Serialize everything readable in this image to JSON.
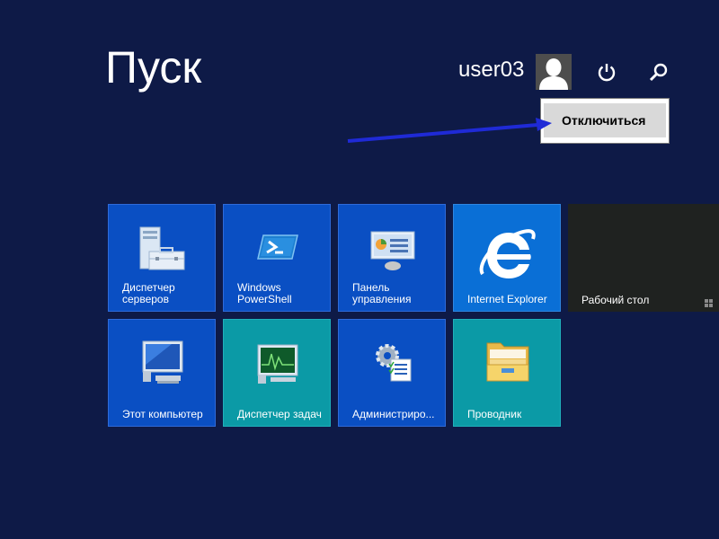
{
  "start": {
    "title": "Пуск"
  },
  "user": {
    "name": "user03"
  },
  "power_menu": {
    "items": [
      {
        "label": "Отключиться"
      }
    ]
  },
  "tiles": [
    {
      "label": "Диспетчер серверов",
      "color": "#0a4fc3",
      "icon": "server-manager-icon"
    },
    {
      "label": "Windows PowerShell",
      "color": "#0a4fc3",
      "icon": "powershell-icon"
    },
    {
      "label": "Панель управления",
      "color": "#0a4fc3",
      "icon": "control-panel-icon"
    },
    {
      "label": "Internet Explorer",
      "color": "#0a6fd6",
      "icon": "internet-explorer-icon"
    },
    {
      "label": "Рабочий стол",
      "color": "#1f2220",
      "icon": "desktop-icon"
    },
    {
      "label": "Этот компьютер",
      "color": "#0a4fc3",
      "icon": "computer-icon"
    },
    {
      "label": "Диспетчер задач",
      "color": "#0b9aa6",
      "icon": "task-manager-icon"
    },
    {
      "label": "Администриро...",
      "color": "#0a4fc3",
      "icon": "admin-tools-icon"
    },
    {
      "label": "Проводник",
      "color": "#0b9aa6",
      "icon": "folder-icon"
    }
  ],
  "colors": {
    "background": "#0e1a47",
    "annotation_arrow": "#1f2ad6",
    "menu_highlight": "#d9d9d9"
  }
}
